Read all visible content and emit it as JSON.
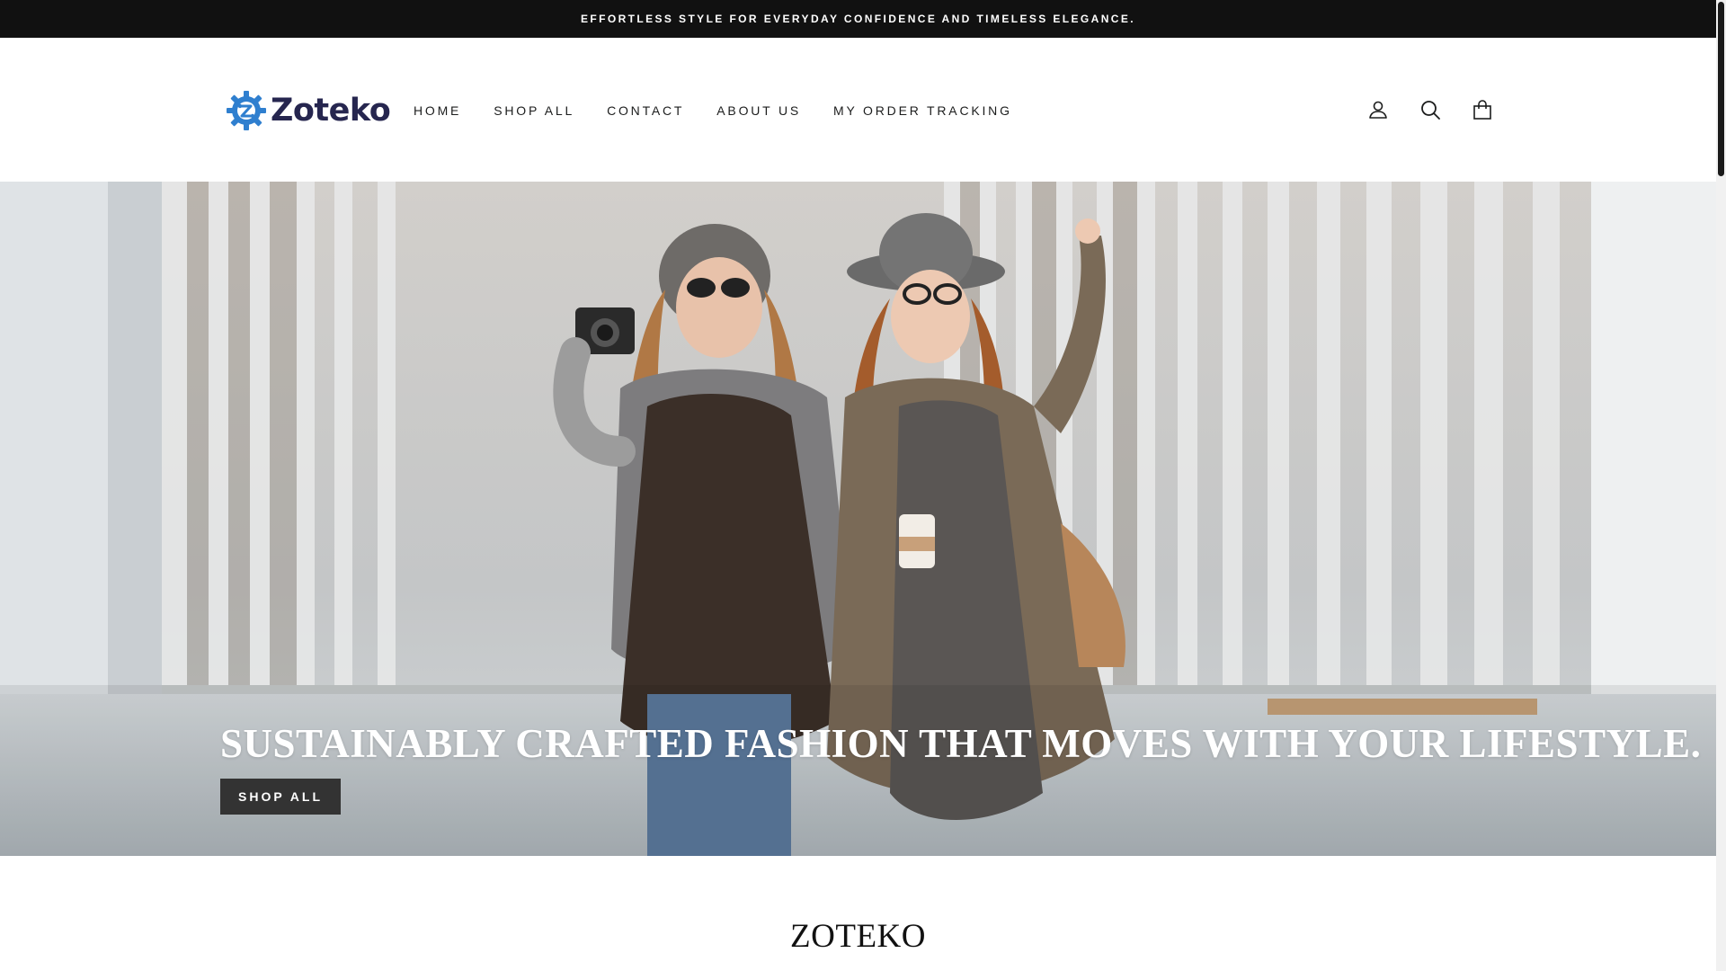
{
  "announcement": {
    "text": "EFFORTLESS STYLE FOR EVERYDAY CONFIDENCE AND TIMELESS ELEGANCE."
  },
  "header": {
    "logo_text": "Zoteko",
    "nav": [
      {
        "label": "HOME"
      },
      {
        "label": "SHOP ALL"
      },
      {
        "label": "CONTACT"
      },
      {
        "label": "ABOUT US"
      },
      {
        "label": "MY ORDER TRACKING"
      }
    ],
    "icons": [
      "account-icon",
      "search-icon",
      "cart-icon"
    ]
  },
  "hero": {
    "title": "SUSTAINABLY CRAFTED FASHION THAT MOVES WITH YOUR LIFESTYLE.",
    "button_label": "SHOP ALL",
    "image": "two-women-laughing-street-photo"
  },
  "section": {
    "title": "ZOTEKO"
  },
  "colors": {
    "announcement_bg": "#111111",
    "logo_text": "#26264f",
    "logo_gear": "#2f7fcf",
    "button_bg": "#333333"
  }
}
